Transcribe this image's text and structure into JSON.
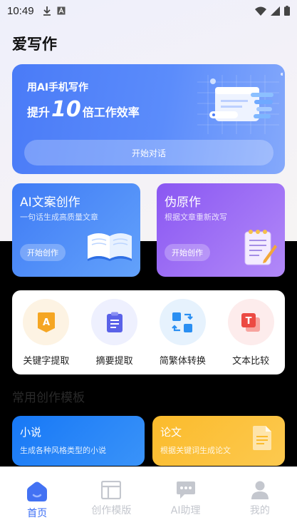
{
  "status_bar": {
    "time": "10:49"
  },
  "app": {
    "title": "爱写作"
  },
  "hero": {
    "title": "用AI手机写作",
    "slogan_prefix": "提升",
    "slogan_number": "10",
    "slogan_suffix": "倍工作效率",
    "button_label": "开始对话"
  },
  "feature_cards": [
    {
      "title": "AI文案创作",
      "subtitle": "一句话生成高质量文章",
      "button_label": "开始创作"
    },
    {
      "title": "伪原作",
      "subtitle": "根据文章重新改写",
      "button_label": "开始创作"
    }
  ],
  "tools": [
    {
      "label": "关键字提取",
      "icon": "keyword-icon",
      "glyph": "A"
    },
    {
      "label": "摘要提取",
      "icon": "summary-icon"
    },
    {
      "label": "简繁体转换",
      "icon": "convert-icon"
    },
    {
      "label": "文本比较",
      "icon": "compare-icon",
      "glyph": "T"
    }
  ],
  "templates_section": {
    "title": "常用创作模板",
    "items": [
      {
        "title": "小说",
        "subtitle": "生成各种风格类型的小说"
      },
      {
        "title": "论文",
        "subtitle": "根据关键词生成论文"
      }
    ]
  },
  "tabbar": {
    "items": [
      {
        "label": "首页",
        "icon": "home-icon",
        "active": true
      },
      {
        "label": "创作模版",
        "icon": "template-icon",
        "active": false
      },
      {
        "label": "AI助理",
        "icon": "chat-icon",
        "active": false
      },
      {
        "label": "我的",
        "icon": "profile-icon",
        "active": false
      }
    ]
  },
  "colors": {
    "accent": "#3b6ef5",
    "hero_blue": "#4a7bf7",
    "card_blue": "#3f7bf5",
    "card_purple": "#8a57f2",
    "template_blue": "#1778f6",
    "template_yellow": "#fbbb2c",
    "tab_inactive": "#c4c7ce"
  }
}
